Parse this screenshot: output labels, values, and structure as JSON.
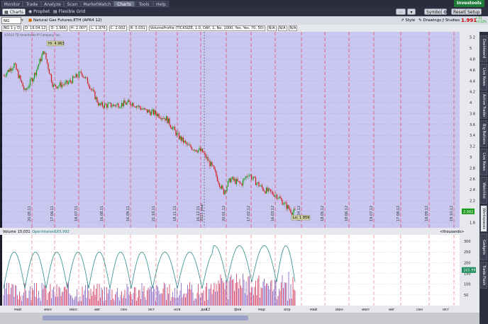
{
  "topnav": {
    "tabs": [
      "Monitor",
      "Trade",
      "Analyze",
      "Scan",
      "MarketWatch",
      "Charts",
      "Tools",
      "Help"
    ],
    "active": "Charts",
    "brand": "Investools"
  },
  "subbar": {
    "charts": "Charts",
    "prophet": "Prophet",
    "flexible_grid": "Flexible Grid",
    "symbols": "Symbols",
    "reset": "Reset",
    "setup": "Setup",
    "price": "1.991",
    "price_tag_top": "+.21",
    "price_tag_bottom": "+0.12%"
  },
  "toolbar": {
    "symbol": "NG",
    "description": "Natural Gas Futures,ETH (APR4 12)",
    "style": "Style",
    "drawings": "Drawings",
    "studies": "Studies",
    "ohlc_line": [
      "/NG 1 y D",
      "D: 16.04.12",
      "O: 1.966",
      "H: 2.007",
      "L: 1.976",
      "C: 2.002",
      "R: 0.031"
    ],
    "study_label": "VolumeProfile (TICKSIZE, 1.0, DAY, 1, No, 1000, Yes, Yes, 70, 50)",
    "na": [
      "N/A",
      "N/A",
      "N/A"
    ],
    "copyright": "©2012 TD Ameritrade IP Company, Inc."
  },
  "chart": {
    "hi_label": "Hi: 4.963",
    "lo_label": "Lo: 1.959",
    "last_price": "2.002",
    "year_marker": "2011 year",
    "price_axis": [
      "5.2",
      "5",
      "4.8",
      "4.6",
      "4.4",
      "4.2",
      "4",
      "3.8",
      "3.6",
      "3.4",
      "3.2",
      "3",
      "2.8",
      "2.6",
      "2.4",
      "2.2",
      "2",
      "1.8"
    ],
    "date_labels": [
      "20.05.11",
      "17.06.11",
      "18.07.11",
      "16.08.11",
      "16.09.11",
      "21.10.11",
      "18.11.11",
      "16.12.11",
      "20.01.12",
      "17.02.12",
      "16.03.12",
      "16.04.12",
      "18.05.12",
      "18.06.12",
      "19.07.12",
      "17.08.12",
      "18.09.12",
      "19.10.12"
    ],
    "lower_panel_label_volume": "Volume",
    "lower_panel_volume_value": "15,031",
    "lower_panel_oi_label": "OpenInterest",
    "lower_panel_oi_value": "165,992",
    "lower_units": "<thousands>",
    "lower_axis": [
      "300",
      "250",
      "200",
      "150",
      "100",
      "50"
    ],
    "lower_last": "165.99",
    "month_axis": [
      "май",
      "июн",
      "июл",
      "авг",
      "сен",
      "окт",
      "ноя",
      "дек",
      "12",
      "фев",
      "мар",
      "апр",
      "май",
      "июн",
      "июл",
      "авг",
      "сен",
      "окт"
    ]
  },
  "right_tabs": [
    "Dashboard",
    "Live News",
    "Active Trader",
    "Big Buttons",
    "Live News Feed",
    "Watchlist",
    "Workspaces",
    "Gadgets",
    "Trade Flash"
  ],
  "colors": {
    "chart_bg": "#c9c7ef",
    "candle_up": "#10a010",
    "candle_down": "#d01a1a",
    "grid": "#e03a3a",
    "oi_line": "#2d8a8a"
  }
}
